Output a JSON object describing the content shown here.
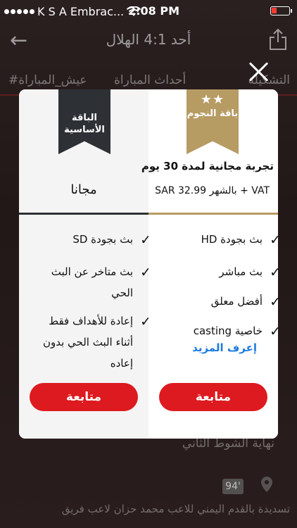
{
  "status_bar": {
    "carrier": "K S A Embrac...",
    "time": "2:08 PM"
  },
  "navbar": {
    "title": "أحد 4:1 الهلال",
    "back_icon": "arrow-left-icon",
    "share_icon": "share-icon"
  },
  "tabs": [
    "التشكيلة",
    "أحداث المباراة",
    "#عيش_المباراة"
  ],
  "background": {
    "event_text": "نهاية الشوط الثاني",
    "minute_badge": "94'",
    "commentary": "تسديدة بالقدم اليمني للاعب محمد حزان لاعب فريق"
  },
  "modal": {
    "close_icon": "close-icon",
    "plans": [
      {
        "id": "stars",
        "ribbon_label": "باقة النجوم",
        "ribbon_color": "#b69b63",
        "headline": "تجربة مجانية لمدة 30 يوم",
        "price": "SAR 32.99 بالشهر + VAT",
        "features": [
          "بث بجودة HD",
          "بث مباشر",
          "أفضل معلق",
          "خاصية casting"
        ],
        "learn_more": "إعرف المزيد",
        "cta": "متابعة"
      },
      {
        "id": "basic",
        "ribbon_label": "الباقة الأساسية",
        "ribbon_color": "#2d3136",
        "price": "مجانا",
        "features": [
          "بث بجودة SD",
          "بث متاخر عن البث الحي",
          "إعادة للأهداف فقط أثناء البث الحي بدون إعاده"
        ],
        "cta": "متابعة"
      }
    ],
    "cta_color": "#dd1a1f",
    "link_color": "#1f7be0"
  }
}
